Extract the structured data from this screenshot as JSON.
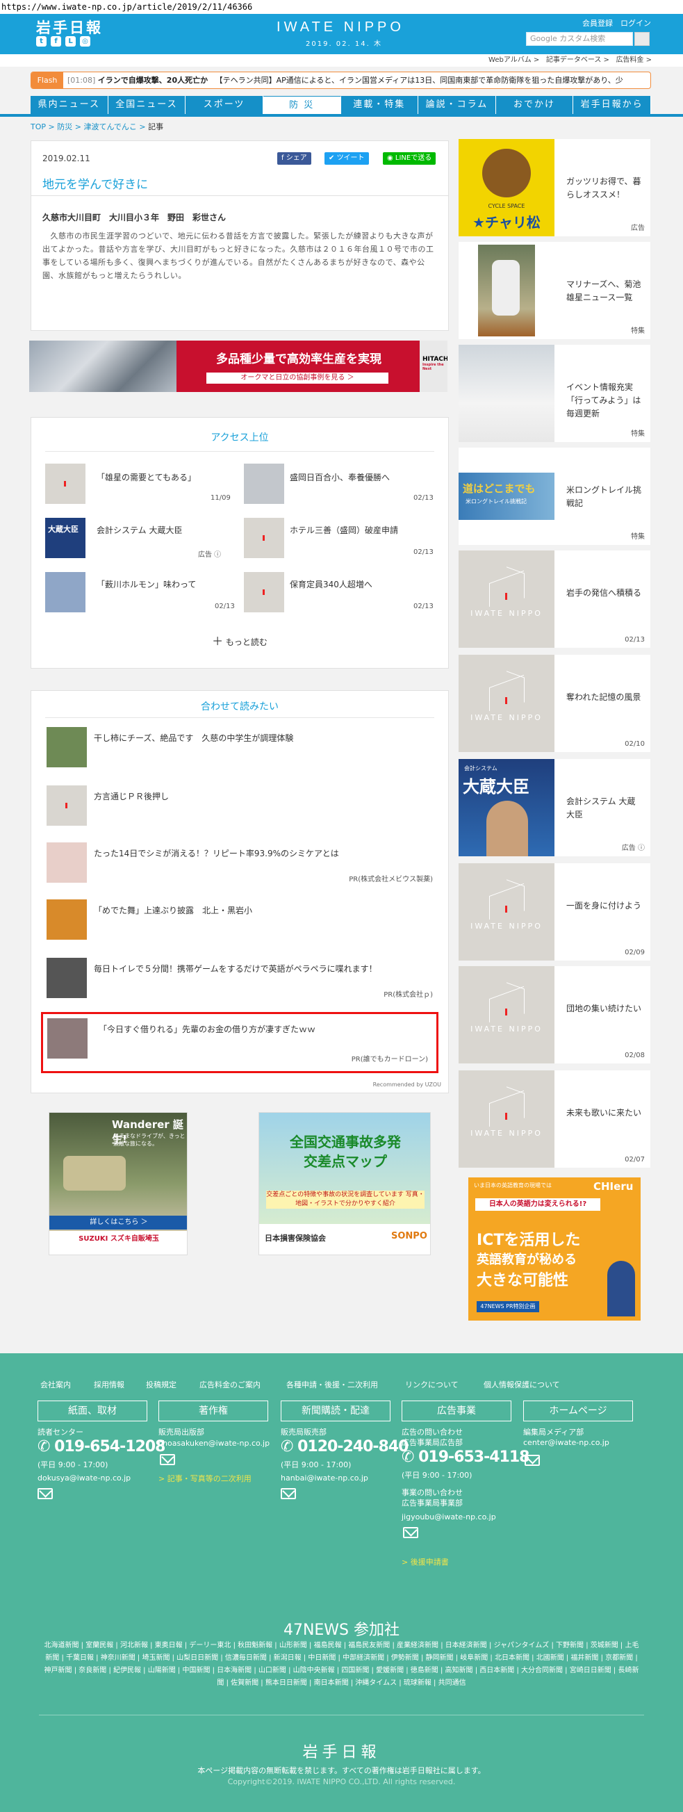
{
  "url": "https://www.iwate-np.co.jp/article/2019/2/11/46366",
  "header": {
    "logo_jp": "岩手日報",
    "logo_en": "IWATE NIPPO",
    "date": "2019. 02. 14.",
    "weekday": "木",
    "register": "会員登録",
    "login": "ログイン",
    "search_placeholder": "Google カスタム検索",
    "social_icons": [
      "twitter-icon",
      "facebook-icon",
      "line-icon",
      "instagram-icon"
    ]
  },
  "subnav": [
    "Webアルバム >",
    "記事データベース >",
    "広告料金 >"
  ],
  "flash": {
    "label": "Flash",
    "time": "[01:08]",
    "headline": "イランで自爆攻撃、20人死亡か",
    "body": "【テヘラン共同】AP通信によると、イラン国営メディアは13日、同国南東部で革命防衛隊を狙った自爆攻撃があり、少"
  },
  "nav": [
    "県内ニュース",
    "全国ニュース",
    "スポーツ",
    "防 災",
    "連載・特集",
    "論説・コラム",
    "おでかけ",
    "岩手日報から"
  ],
  "breadcrumb": [
    "TOP",
    "防災",
    "津波てんでんこ",
    "記事"
  ],
  "article": {
    "date": "2019.02.11",
    "title": "地元を学んで好きに",
    "share": "シェア",
    "tweet": "ツイート",
    "line": "LINEで送る",
    "byline": "久慈市大川目町　大川目小３年　野田　彩世さん",
    "body": "　久慈市の市民生涯学習のつどいで、地元に伝わる昔話を方言で披露した。緊張したが練習よりも大きな声が出てよかった。昔話や方言を学び、大川目町がもっと好きになった。久慈市は２０１６年台風１０号で市の工事をしている場所も多く、復興へまちづくりが進んでいる。自然がたくさんあるまちが好きなので、森や公園、水族館がもっと増えたらうれしい。"
  },
  "ad_banner": {
    "headline": "多品種少量で高効率生産を実現",
    "sub": "オークマと日立の協創事例を見る ＞",
    "brand": "HITACHI",
    "brand_sub": "Inspire the Next"
  },
  "access": {
    "title": "アクセス上位",
    "items": [
      {
        "text": "「雄星の需要とてもある」",
        "date": "11/09"
      },
      {
        "text": "盛岡日百合小、奉養優勝へ",
        "date": "02/13"
      },
      {
        "text": "会計システム 大蔵大臣",
        "date": "広告 ⓘ"
      },
      {
        "text": "ホテル三善（盛岡）破産申請",
        "date": "02/13"
      },
      {
        "text": "「薮川ホルモン」味わって",
        "date": "02/13"
      },
      {
        "text": "保育定員340人超増へ",
        "date": "02/13"
      }
    ],
    "more": "もっと読む"
  },
  "recommend": {
    "title": "合わせて読みたい",
    "items": [
      {
        "text": "干し柿にチーズ、絶品です　久慈の中学生が調理体験",
        "source": ""
      },
      {
        "text": "方言通じＰＲ後押し",
        "source": ""
      },
      {
        "text": "たった14日でシミが消える！？リピート率93.9%のシミケアとは",
        "source": "PR(株式会社メビウス製薬)"
      },
      {
        "text": "「めでた舞」上達ぶり披露　北上・黒岩小",
        "source": ""
      },
      {
        "text": "毎日トイレで５分間！携帯ゲームをするだけで英語がペラペラに喋れます！",
        "source": "PR(株式会社ｐ)"
      },
      {
        "text": "「今日すぐ借りれる」先輩のお金の借り方が凄すぎたｗｗ",
        "source": "PR(誰でもカードローン)"
      }
    ],
    "powered": "Recommended by UZOU"
  },
  "ads_bottom": {
    "suzuki_title": "Wanderer 誕生!",
    "suzuki_sub": "気ままなドライブが、きっと素敵な旅になる。",
    "suzuki_cta": "詳しくはこちら ＞",
    "suzuki_brand": "SUZUKI スズキ自販埼玉",
    "traffic_title1": "全国交通事故多発",
    "traffic_title2": "交差点マップ",
    "traffic_sub": "交差点ごとの特徴や事故の状況を調査しています 写真・地図・イラストで分かりやすく紹介",
    "traffic_org": "日本損害保険協会",
    "traffic_brand": "SONPO",
    "cheru_brand": "CHIeru",
    "cheru_top": "いま日本の英語教育の現場では",
    "cheru_q": "日本人の英語力は変えられる!?",
    "cheru_main1": "ICTを活用した",
    "cheru_main2": "英語教育が秘める",
    "cheru_main3": "大きな可能性",
    "cheru_foot": "47NEWS PR特別企画"
  },
  "sidebar": [
    {
      "text": "ガッツリお得で、暮らしオススメ！",
      "date": "広告",
      "img": "chari"
    },
    {
      "text": "マリナーズへ、菊池雄星ニュース一覧",
      "date": "特集",
      "img": "baseball"
    },
    {
      "text": "イベント情報充実「行ってみよう」は毎週更新",
      "date": "特集",
      "img": "snow"
    },
    {
      "text": "米ロングトレイル挑戦記",
      "date": "特集",
      "img": "trail"
    },
    {
      "text": "岩手の発信へ積積る",
      "date": "02/13",
      "img": "logo"
    },
    {
      "text": "奪われた記憶の風景",
      "date": "02/10",
      "img": "logo"
    },
    {
      "text": "会計システム 大蔵大臣",
      "date": "広告 ⓘ",
      "img": "okura"
    },
    {
      "text": "一面を身に付けよう",
      "date": "02/09",
      "img": "logo"
    },
    {
      "text": "団地の集い続けたい",
      "date": "02/08",
      "img": "logo"
    },
    {
      "text": "未来も歌いに来たい",
      "date": "02/07",
      "img": "logo"
    }
  ],
  "sidebar_texts": {
    "chari_brand": "CYCLE SPACE",
    "chari_name": "★チャリ松",
    "trail": "道はどこまでも",
    "trail_sub": "米ロングトレイル挑戦記",
    "okura_small": "会計システム",
    "okura_big": "大蔵大臣",
    "logo_text": "IWATE NIPPO"
  },
  "footer": {
    "links": [
      "会社案内",
      "採用情報",
      "投稿規定",
      "広告料金のご案内",
      "各種申請・後援・二次利用",
      "リンクについて",
      "個人情報保護について"
    ],
    "boxes": [
      "紙面、取材",
      "著作権",
      "新聞購読・配達",
      "広告事業",
      "ホームページ"
    ],
    "col1_label": "読者センター",
    "col1_phone": "019-654-1208",
    "col1_hours": "(平日 9:00 - 17:00)",
    "col1_mail": "dokusya@iwate-np.co.jp",
    "col2_label": "販売局出版部",
    "col2_mail": "choasakuken@iwate-np.co.jp",
    "col2_link": "> 記事・写真等の二次利用",
    "col3_label": "販売局販売部",
    "col3_phone": "0120-240-840",
    "col3_hours": "(平日 9:00 - 17:00)",
    "col3_mail": "hanbai@iwate-np.co.jp",
    "col4_label1": "広告の問い合わせ",
    "col4_label2": "広告事業局広告部",
    "col4_phone": "019-653-4118",
    "col4_hours": "(平日 9:00 - 17:00)",
    "col4_label3": "事業の問い合わせ",
    "col4_label4": "広告事業局事業部",
    "col4_mail": "jigyoubu@iwate-np.co.jp",
    "col4_link": "> 後援申請書",
    "col5_label": "編集局メディア部",
    "col5_mail": "center@iwate-np.co.jp",
    "news47": "47NEWS 参加社",
    "papers": "北海道新聞 | 室蘭民報 | 河北新報 | 東奥日報 | デーリー東北 | 秋田魁新報 | 山形新聞 | 福島民報 | 福島民友新聞 | 産業経済新聞 | 日本経済新聞 | ジャパンタイムズ | 下野新聞 | 茨城新聞 | 上毛新聞 | 千葉日報 | 神奈川新聞 | 埼玉新聞 | 山梨日日新聞 | 信濃毎日新聞 | 新潟日報 | 中日新聞 | 中部経済新聞 | 伊勢新聞 | 静岡新聞 | 岐阜新聞 | 北日本新聞 | 北國新聞 | 福井新聞 | 京都新聞 | 神戸新聞 | 奈良新聞 | 紀伊民報 | 山陽新聞 | 中国新聞 | 日本海新聞 | 山口新聞 | 山陰中央新報 | 四国新聞 | 愛媛新聞 | 徳島新聞 | 高知新聞 | 西日本新聞 | 大分合同新聞 | 宮崎日日新聞 | 長崎新聞 | 佐賀新聞 | 熊本日日新聞 | 南日本新聞 | 沖縄タイムス | 琉球新報 | 共同通信",
    "logo": "岩手日報",
    "notice": "本ページ掲載内容の無断転載を禁じます。すべての著作権は岩手日報社に属します。",
    "copyright": "Copyright©2019. IWATE NIPPO CO.,LTD. All rights reserved."
  }
}
